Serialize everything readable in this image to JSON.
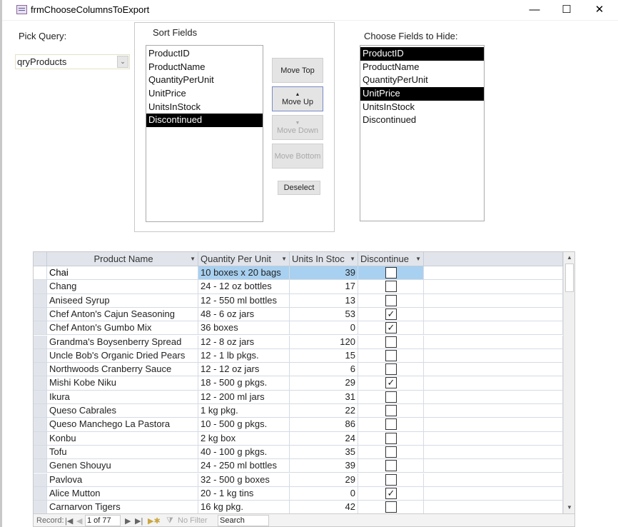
{
  "window": {
    "title": "frmChooseColumnsToExport",
    "minimize": "—",
    "maximize": "☐",
    "close": "✕"
  },
  "pick_query": {
    "label": "Pick Query:",
    "value": "qryProducts"
  },
  "sort_fields": {
    "label": "Sort Fields",
    "items": [
      "ProductID",
      "ProductName",
      "QuantityPerUnit",
      "UnitPrice",
      "UnitsInStock",
      "Discontinued"
    ],
    "selected": [
      5
    ]
  },
  "buttons": {
    "move_top": "Move Top",
    "move_up": "Move Up",
    "move_down": "Move Down",
    "move_bottom": "Move Bottom",
    "deselect": "Deselect"
  },
  "hide_fields": {
    "label": "Choose Fields to Hide:",
    "items": [
      "ProductID",
      "ProductName",
      "QuantityPerUnit",
      "UnitPrice",
      "UnitsInStock",
      "Discontinued"
    ],
    "selected": [
      0,
      3
    ]
  },
  "datasheet": {
    "columns": [
      "Product Name",
      "Quantity Per Unit",
      "Units In Stoc",
      "Discontinue"
    ],
    "rows": [
      [
        "Chai",
        "10 boxes x 20 bags",
        "39",
        false
      ],
      [
        "Chang",
        "24 - 12 oz bottles",
        "17",
        false
      ],
      [
        "Aniseed Syrup",
        "12 - 550 ml bottles",
        "13",
        false
      ],
      [
        "Chef Anton's Cajun Seasoning",
        "48 - 6 oz jars",
        "53",
        true
      ],
      [
        "Chef Anton's Gumbo Mix",
        "36 boxes",
        "0",
        true
      ],
      [
        "Grandma's Boysenberry Spread",
        "12 - 8 oz jars",
        "120",
        false
      ],
      [
        "Uncle Bob's Organic Dried Pears",
        "12 - 1 lb pkgs.",
        "15",
        false
      ],
      [
        "Northwoods Cranberry Sauce",
        "12 - 12 oz jars",
        "6",
        false
      ],
      [
        "Mishi Kobe Niku",
        "18 - 500 g pkgs.",
        "29",
        true
      ],
      [
        "Ikura",
        "12 - 200 ml jars",
        "31",
        false
      ],
      [
        "Queso Cabrales",
        "1 kg pkg.",
        "22",
        false
      ],
      [
        "Queso Manchego La Pastora",
        "10 - 500 g pkgs.",
        "86",
        false
      ],
      [
        "Konbu",
        "2 kg box",
        "24",
        false
      ],
      [
        "Tofu",
        "40 - 100 g pkgs.",
        "35",
        false
      ],
      [
        "Genen Shouyu",
        "24 - 250 ml bottles",
        "39",
        false
      ],
      [
        "Pavlova",
        "32 - 500 g boxes",
        "29",
        false
      ],
      [
        "Alice Mutton",
        "20 - 1 kg tins",
        "0",
        true
      ],
      [
        "Carnarvon Tigers",
        "16 kg pkg.",
        "42",
        false
      ]
    ]
  },
  "record_nav": {
    "label": "Record:",
    "position": "1 of 77",
    "filter": "No Filter",
    "search": "Search"
  }
}
